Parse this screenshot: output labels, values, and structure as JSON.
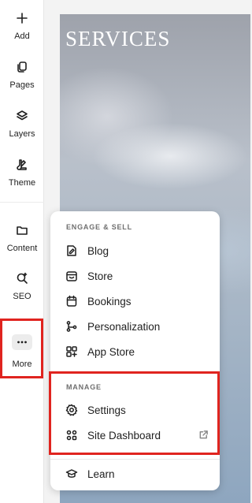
{
  "sidebar": {
    "items": [
      {
        "label": "Add",
        "icon": "plus-icon"
      },
      {
        "label": "Pages",
        "icon": "pages-icon"
      },
      {
        "label": "Layers",
        "icon": "layers-icon"
      },
      {
        "label": "Theme",
        "icon": "theme-icon"
      },
      {
        "label": "Content",
        "icon": "folder-icon"
      },
      {
        "label": "SEO",
        "icon": "seo-search-icon"
      },
      {
        "label": "More",
        "icon": "more-dots-icon"
      }
    ]
  },
  "canvas": {
    "title": "SERVICES"
  },
  "menu": {
    "engage_title": "ENGAGE & SELL",
    "engage_items": [
      {
        "label": "Blog",
        "icon": "blog-icon"
      },
      {
        "label": "Store",
        "icon": "store-icon"
      },
      {
        "label": "Bookings",
        "icon": "calendar-icon"
      },
      {
        "label": "Personalization",
        "icon": "personalization-icon"
      },
      {
        "label": "App Store",
        "icon": "app-store-icon"
      }
    ],
    "manage_title": "MANAGE",
    "manage_items": [
      {
        "label": "Settings",
        "icon": "gear-icon"
      },
      {
        "label": "Site Dashboard",
        "icon": "dashboard-icon",
        "external": "external-link-icon"
      }
    ],
    "footer_items": [
      {
        "label": "Learn",
        "icon": "graduation-cap-icon"
      }
    ]
  },
  "colors": {
    "highlight": "#e0241f",
    "text": "#1f1f1f",
    "section_label": "#6f6f6f"
  }
}
